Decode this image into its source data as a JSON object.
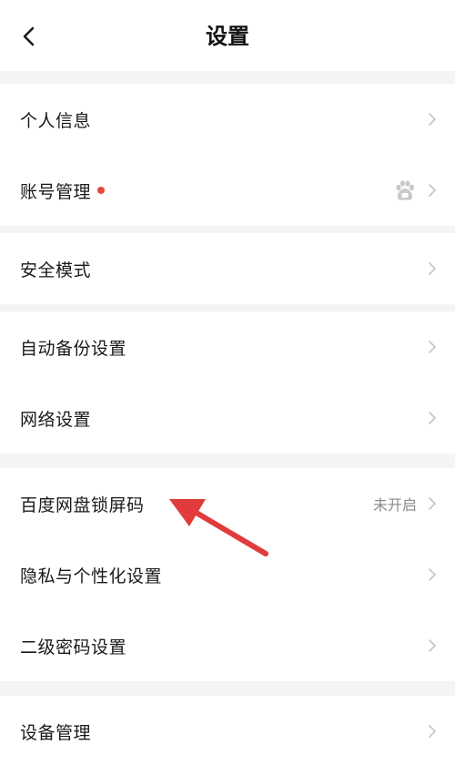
{
  "header": {
    "title": "设置"
  },
  "icons": {
    "back": "chevron-left-icon",
    "chevron": "chevron-right-icon",
    "account_badge": "baidu-paw-icon",
    "annotation": "red-arrow-annotation"
  },
  "colors": {
    "background": "#f4f4f6",
    "card": "#ffffff",
    "accent_red": "#e5483e",
    "annotation_red": "#e23b3b",
    "chevron": "#c4c4c4",
    "secondary_text": "#8a8a8a"
  },
  "groups": [
    {
      "items": [
        {
          "label": "个人信息"
        },
        {
          "label": "账号管理",
          "has_red_dot": true,
          "has_baidu_icon": true
        }
      ]
    },
    {
      "items": [
        {
          "label": "安全模式"
        }
      ]
    },
    {
      "items": [
        {
          "label": "自动备份设置"
        },
        {
          "label": "网络设置"
        }
      ]
    },
    {
      "items": [
        {
          "label": "百度网盘锁屏码",
          "status": "未开启"
        },
        {
          "label": "隐私与个性化设置"
        },
        {
          "label": "二级密码设置"
        }
      ]
    },
    {
      "items": [
        {
          "label": "设备管理"
        }
      ]
    }
  ]
}
